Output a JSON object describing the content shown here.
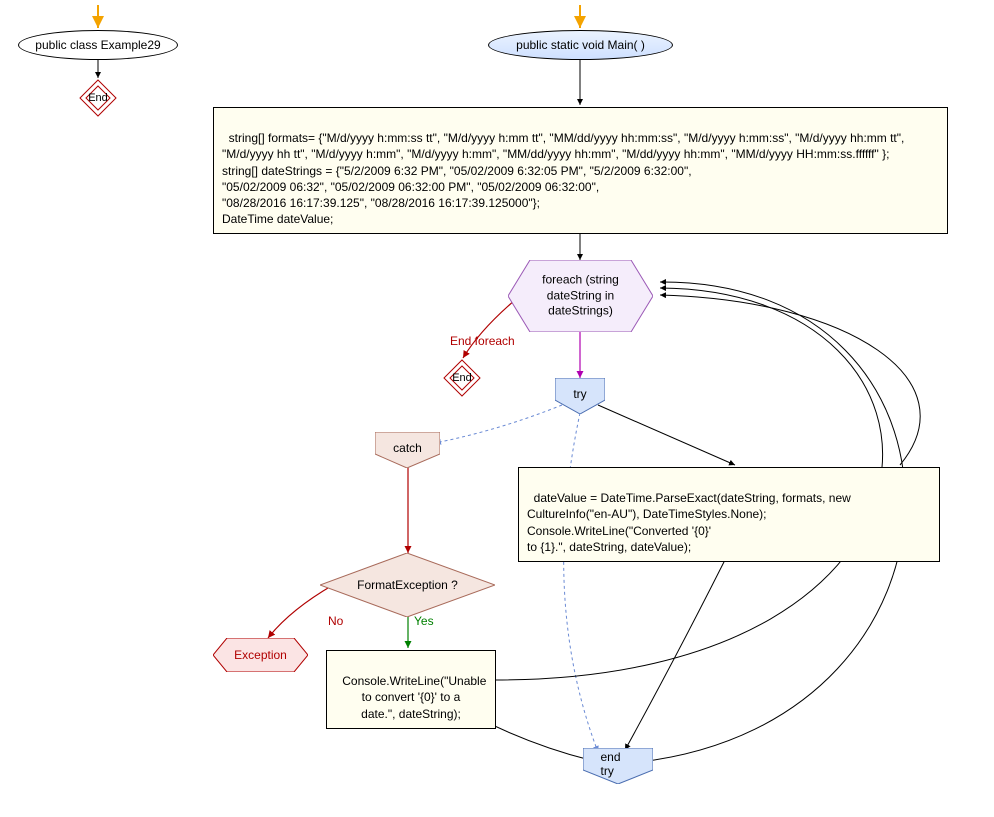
{
  "class_header": "public class Example29",
  "main_header": "public static void Main( )",
  "end_label": "End",
  "declarations": "string[] formats= {\"M/d/yyyy h:mm:ss tt\", \"M/d/yyyy h:mm tt\", \"MM/dd/yyyy hh:mm:ss\", \"M/d/yyyy h:mm:ss\", \"M/d/yyyy hh:mm tt\", \"M/d/yyyy hh tt\", \"M/d/yyyy h:mm\", \"M/d/yyyy h:mm\", \"MM/dd/yyyy hh:mm\", \"M/dd/yyyy hh:mm\", \"MM/d/yyyy HH:mm:ss.ffffff\" };\nstring[] dateStrings = {\"5/2/2009 6:32 PM\", \"05/02/2009 6:32:05 PM\", \"5/2/2009 6:32:00\",\n\"05/02/2009 06:32\", \"05/02/2009 06:32:00 PM\", \"05/02/2009 06:32:00\",\n\"08/28/2016 16:17:39.125\", \"08/28/2016 16:17:39.125000\"};\nDateTime dateValue;",
  "foreach_label": "foreach (string dateString in dateStrings)",
  "end_foreach_label": "End foreach",
  "try_label": "try",
  "try_body": "dateValue = DateTime.ParseExact(dateString, formats, new\nCultureInfo(\"en-AU\"), DateTimeStyles.None);\nConsole.WriteLine(\"Converted '{0}'\nto {1}.\", dateString, dateValue);",
  "catch_label": "catch",
  "format_exception_label": "FormatException ?",
  "no_label": "No",
  "yes_label": "Yes",
  "exception_label": "Exception",
  "catch_body": "Console.WriteLine(\"Unable\nto convert '{0}' to a\ndate.\", dateString);",
  "end_try_label": "end try",
  "colors": {
    "arrow_yellow": "#f4a300",
    "arrow_red": "#b00000",
    "arrow_green": "#008000",
    "arrow_magenta": "#b000b0",
    "arrow_blue_dash": "#6a8ad4",
    "hex_fill": "#f5edfb",
    "hex_stroke": "#9b59b6",
    "try_fill": "#d6e4fb",
    "try_stroke": "#4a6db0",
    "catch_fill": "#f5e6e0",
    "catch_stroke": "#a86a5a",
    "code_fill": "#FFFEF0",
    "exception_fill": "#fbe4e4"
  }
}
